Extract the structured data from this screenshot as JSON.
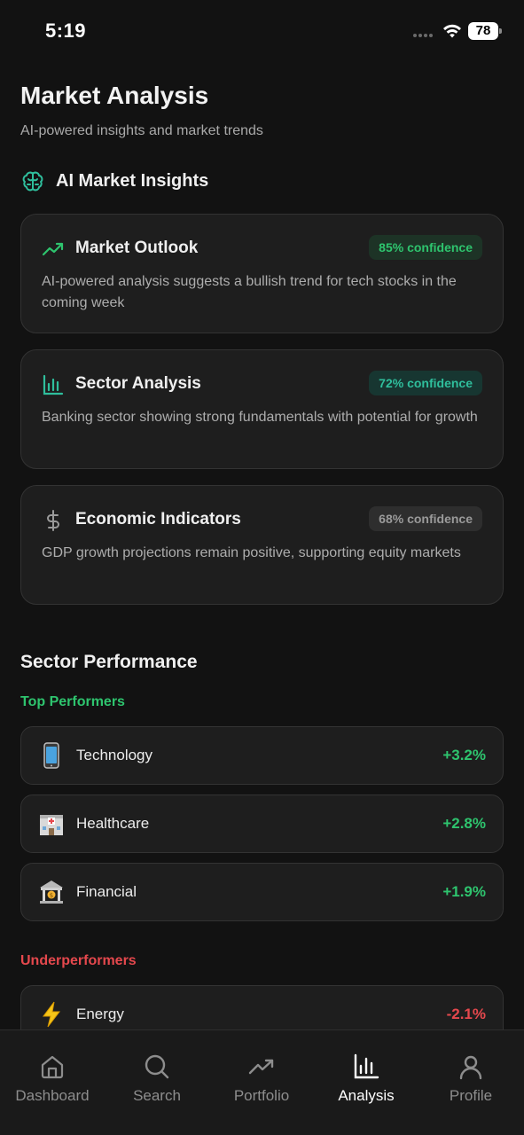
{
  "status_bar": {
    "time": "5:19",
    "battery": "78"
  },
  "header": {
    "title": "Market Analysis",
    "subtitle": "AI-powered insights and market trends"
  },
  "insights_section": {
    "title": "AI Market Insights",
    "icon": "brain-icon"
  },
  "insights": [
    {
      "title": "Market Outlook",
      "confidence": "85% confidence",
      "description": "AI-powered analysis suggests a bullish trend for tech stocks in the coming week",
      "icon": "trending-up-icon"
    },
    {
      "title": "Sector Analysis",
      "confidence": "72% confidence",
      "description": "Banking sector showing strong fundamentals with potential for growth",
      "icon": "bar-chart-icon"
    },
    {
      "title": "Economic Indicators",
      "confidence": "68% confidence",
      "description": "GDP growth projections remain positive, supporting equity markets",
      "icon": "dollar-icon"
    }
  ],
  "sector_performance": {
    "title": "Sector Performance",
    "top_label": "Top Performers",
    "under_label": "Underperformers",
    "top": [
      {
        "name": "Technology",
        "change": "+3.2%",
        "icon": "mobile-phone-icon"
      },
      {
        "name": "Healthcare",
        "change": "+2.8%",
        "icon": "hospital-icon"
      },
      {
        "name": "Financial",
        "change": "+1.9%",
        "icon": "bank-icon"
      }
    ],
    "under": [
      {
        "name": "Energy",
        "change": "-2.1%",
        "icon": "lightning-icon"
      }
    ]
  },
  "tabs": [
    {
      "label": "Dashboard",
      "icon": "home-icon"
    },
    {
      "label": "Search",
      "icon": "search-icon"
    },
    {
      "label": "Portfolio",
      "icon": "trending-up-icon"
    },
    {
      "label": "Analysis",
      "icon": "bar-chart-icon",
      "active": true
    },
    {
      "label": "Profile",
      "icon": "user-icon"
    }
  ],
  "colors": {
    "background": "#121212",
    "card": "#1e1e1e",
    "positive": "#2ec46e",
    "negative": "#e5484d",
    "teal": "#2fbe9c"
  }
}
